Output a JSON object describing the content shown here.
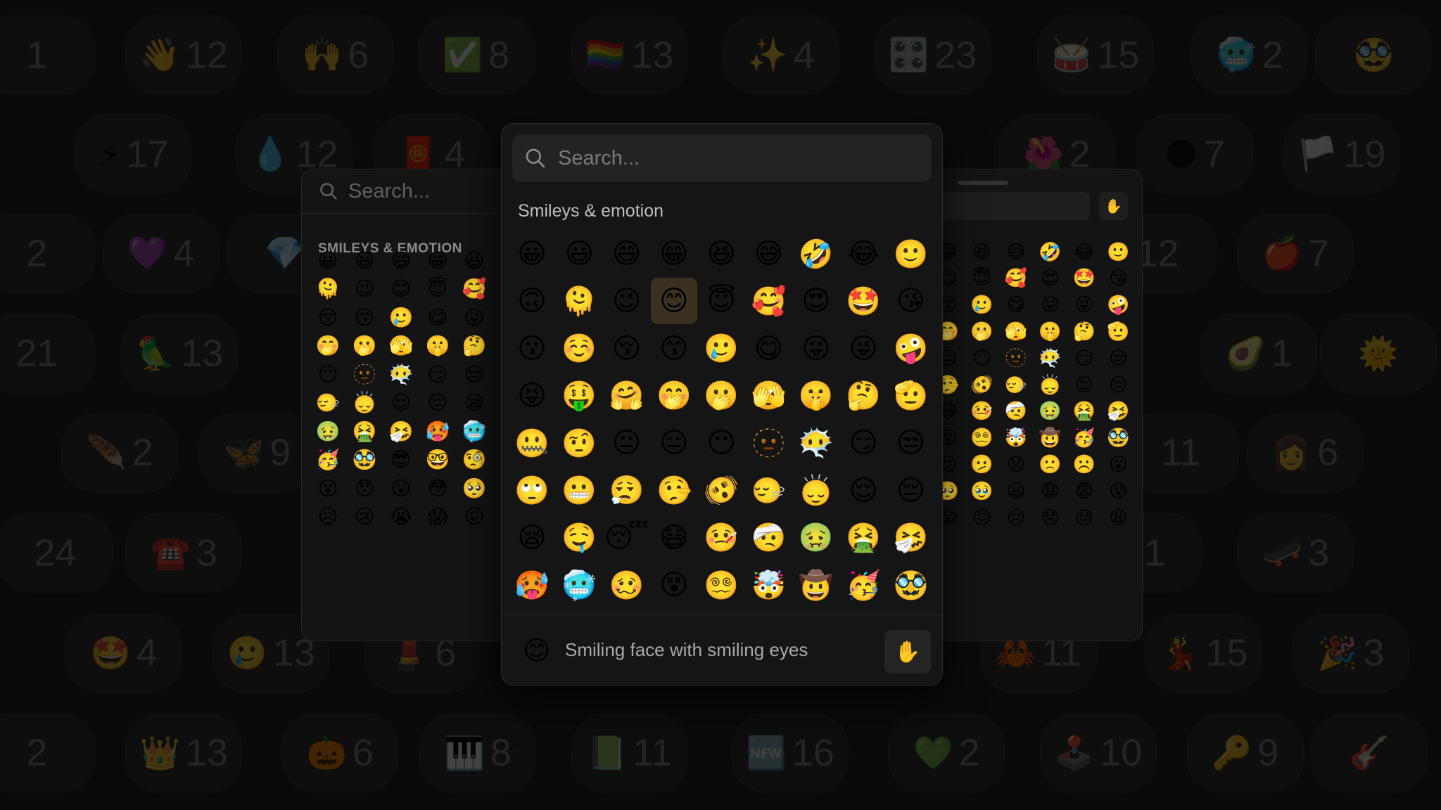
{
  "background_pills": [
    [
      [
        "",
        "1"
      ],
      [
        "👋",
        "12"
      ],
      [
        "🙌",
        "6"
      ],
      [
        "✅",
        "8"
      ],
      [
        "🏳️‍🌈",
        "13"
      ],
      [
        "✨",
        "4"
      ],
      [
        "🎛️",
        "23"
      ],
      [
        "🥁",
        "15"
      ],
      [
        "🥶",
        "2"
      ],
      [
        "🥸",
        ""
      ]
    ],
    [
      [
        "⚡",
        "17"
      ],
      [
        "💧",
        "12"
      ],
      [
        "🧧",
        "4"
      ],
      [
        "🌺",
        "2"
      ],
      [
        "🌑",
        "7"
      ],
      [
        "🏳️",
        "19"
      ]
    ],
    [
      [
        "",
        "2"
      ],
      [
        "💜",
        "4"
      ],
      [
        "💎",
        ""
      ],
      [
        "",
        "12"
      ],
      [
        "🍎",
        "7"
      ]
    ],
    [
      [
        "",
        "21"
      ],
      [
        "🦜",
        "13"
      ],
      [
        "🥑",
        "1"
      ],
      [
        "🌞",
        ""
      ]
    ],
    [
      [
        "🪶",
        "2"
      ],
      [
        "🦋",
        "9"
      ],
      [
        "",
        "11"
      ],
      [
        "👩",
        "6"
      ]
    ],
    [
      [
        "",
        "24"
      ],
      [
        "☎️",
        "3"
      ],
      [
        "",
        "21"
      ],
      [
        "🛹",
        "3"
      ]
    ],
    [
      [
        "🤩",
        "4"
      ],
      [
        "🥲",
        "13"
      ],
      [
        "💄",
        "6"
      ],
      [
        "🦀",
        "11"
      ],
      [
        "💃",
        "15"
      ],
      [
        "🎉",
        "3"
      ]
    ],
    [
      [
        "",
        "2"
      ],
      [
        "👑",
        "13"
      ],
      [
        "🎃",
        "6"
      ],
      [
        "🎹",
        "8"
      ],
      [
        "📗",
        "11"
      ],
      [
        "🆕",
        "16"
      ],
      [
        "💚",
        "2"
      ],
      [
        "🕹️",
        "10"
      ],
      [
        "🔑",
        "9"
      ],
      [
        "🎸",
        ""
      ]
    ]
  ],
  "left_picker": {
    "search_placeholder": "Search...",
    "category_title": "SMILEYS & EMOTION",
    "emojis": [
      [
        "😀",
        "😃",
        "😄",
        "😁",
        "😆"
      ],
      [
        "🫠",
        "😉",
        "😊",
        "😇",
        "🥰"
      ],
      [
        "😚",
        "😙",
        "🥲",
        "😋",
        "😛"
      ],
      [
        "🤭",
        "🫢",
        "🫣",
        "🤫",
        "🤔"
      ],
      [
        "😶",
        "🫥",
        "😶‍🌫️",
        "😏",
        "😒"
      ],
      [
        "🙂‍↔️",
        "🙂‍↕️",
        "😌",
        "😔",
        "😪"
      ],
      [
        "🤢",
        "🤮",
        "🤧",
        "🥵",
        "🥶"
      ],
      [
        "🥳",
        "🥸",
        "😎",
        "🤓",
        "🧐"
      ],
      [
        "😮",
        "😯",
        "😲",
        "😳",
        "🥺"
      ],
      [
        "😥",
        "😢",
        "😭",
        "😱",
        "😖"
      ]
    ]
  },
  "right_picker": {
    "skin_tone_icon": "✋",
    "emojis": [
      [
        "😁",
        "😆",
        "😅",
        "🤣",
        "😂",
        "🙂"
      ],
      [
        "😊",
        "😇",
        "🥰",
        "😍",
        "🤩",
        "😘"
      ],
      [
        "😙",
        "🥲",
        "😋",
        "😛",
        "😜",
        "🤪"
      ],
      [
        "🤭",
        "🫢",
        "🫣",
        "🤫",
        "🤔",
        "🫡"
      ],
      [
        "😑",
        "😶",
        "🫥",
        "😶‍🌫️",
        "😏",
        "😒"
      ],
      [
        "🤥",
        "🫨",
        "🙂‍↔️",
        "🙂‍↕️",
        "😌",
        "😔"
      ],
      [
        "😷",
        "🤒",
        "🤕",
        "🤢",
        "🤮",
        "🤧"
      ],
      [
        "😵",
        "😵‍💫",
        "🤯",
        "🤠",
        "🥳",
        "🥸"
      ],
      [
        "😕",
        "🫤",
        "😟",
        "🙁",
        "☹️",
        "😮"
      ],
      [
        "🥺",
        "🥹",
        "😦",
        "😧",
        "😨",
        "😰"
      ],
      [
        "😱",
        "😖",
        "😣",
        "😞",
        "😓",
        "😩"
      ]
    ]
  },
  "center_picker": {
    "search_placeholder": "Search...",
    "category_title": "Smileys & emotion",
    "selected": [
      1,
      3
    ],
    "emojis": [
      [
        "😀",
        "😃",
        "😄",
        "😁",
        "😆",
        "😅",
        "🤣",
        "😂",
        "🙂"
      ],
      [
        "🙃",
        "🫠",
        "😉",
        "😊",
        "😇",
        "🥰",
        "😍",
        "🤩",
        "😘"
      ],
      [
        "😗",
        "☺️",
        "😚",
        "😙",
        "🥲",
        "😋",
        "😛",
        "😜",
        "🤪"
      ],
      [
        "😝",
        "🤑",
        "🤗",
        "🤭",
        "🫢",
        "🫣",
        "🤫",
        "🤔",
        "🫡"
      ],
      [
        "🤐",
        "🤨",
        "😐",
        "😑",
        "😶",
        "🫥",
        "😶‍🌫️",
        "😏",
        "😒"
      ],
      [
        "🙄",
        "😬",
        "😮‍💨",
        "🤥",
        "🫨",
        "🙂‍↔️",
        "🙂‍↕️",
        "😌",
        "😔"
      ],
      [
        "😪",
        "🤤",
        "😴",
        "😷",
        "🤒",
        "🤕",
        "🤢",
        "🤮",
        "🤧"
      ],
      [
        "🥵",
        "🥶",
        "🥴",
        "😵",
        "😵‍💫",
        "🤯",
        "🤠",
        "🥳",
        "🥸"
      ]
    ],
    "footer": {
      "preview_emoji": "😊",
      "preview_name": "Smiling face with smiling eyes",
      "skin_tone_icon": "✋"
    }
  },
  "colors": {
    "background": "#0a0a0a",
    "panel": "#151515",
    "selected_cell": "#3a3120"
  }
}
